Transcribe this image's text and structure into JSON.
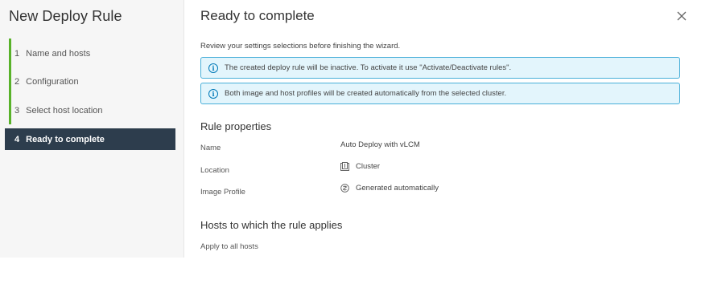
{
  "wizard": {
    "title": "New Deploy Rule",
    "steps": [
      {
        "num": "1",
        "label": "Name and hosts"
      },
      {
        "num": "2",
        "label": "Configuration"
      },
      {
        "num": "3",
        "label": "Select host location"
      },
      {
        "num": "4",
        "label": "Ready to complete"
      }
    ],
    "active_step": 4
  },
  "main": {
    "title": "Ready to complete",
    "intro": "Review your settings selections before finishing the wizard.",
    "alerts": [
      "The created deploy rule will be inactive. To activate it use \"Activate/Deactivate rules\".",
      "Both image and host profiles will be created automatically from the selected cluster."
    ],
    "rule_properties": {
      "heading": "Rule properties",
      "rows": [
        {
          "label": "Name",
          "value": "Auto Deploy with vLCM",
          "icon": ""
        },
        {
          "label": "Location",
          "value": "Cluster",
          "icon": "cluster-icon"
        },
        {
          "label": "Image Profile",
          "value": "Generated automatically",
          "icon": "image-profile-icon"
        }
      ]
    },
    "hosts": {
      "heading": "Hosts to which the rule applies",
      "value": "Apply to all hosts"
    }
  },
  "colors": {
    "accent_green": "#59b22a",
    "active_step_bg": "#2d3d4d",
    "alert_bg": "#e3f5fc",
    "alert_border": "#49afd9",
    "info_icon": "#0079b8"
  }
}
